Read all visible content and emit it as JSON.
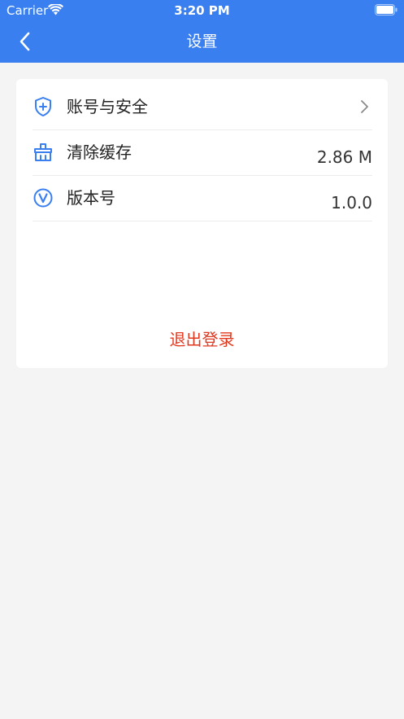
{
  "status_bar": {
    "carrier": "Carrier",
    "time": "3:20 PM"
  },
  "nav": {
    "title": "设置",
    "back_icon": "chevron-left-icon"
  },
  "settings": {
    "items": [
      {
        "label": "账号与安全",
        "value": "",
        "icon": "shield-plus-icon",
        "has_chevron": true
      },
      {
        "label": "清除缓存",
        "value": "2.86 M",
        "icon": "broom-icon",
        "has_chevron": false
      },
      {
        "label": "版本号",
        "value": "1.0.0",
        "icon": "version-v-icon",
        "has_chevron": false
      }
    ],
    "logout_label": "退出登录"
  },
  "colors": {
    "header": "#3a7ff0",
    "icon": "#3a7ff0",
    "logout": "#e0391f",
    "background": "#f4f4f4"
  }
}
